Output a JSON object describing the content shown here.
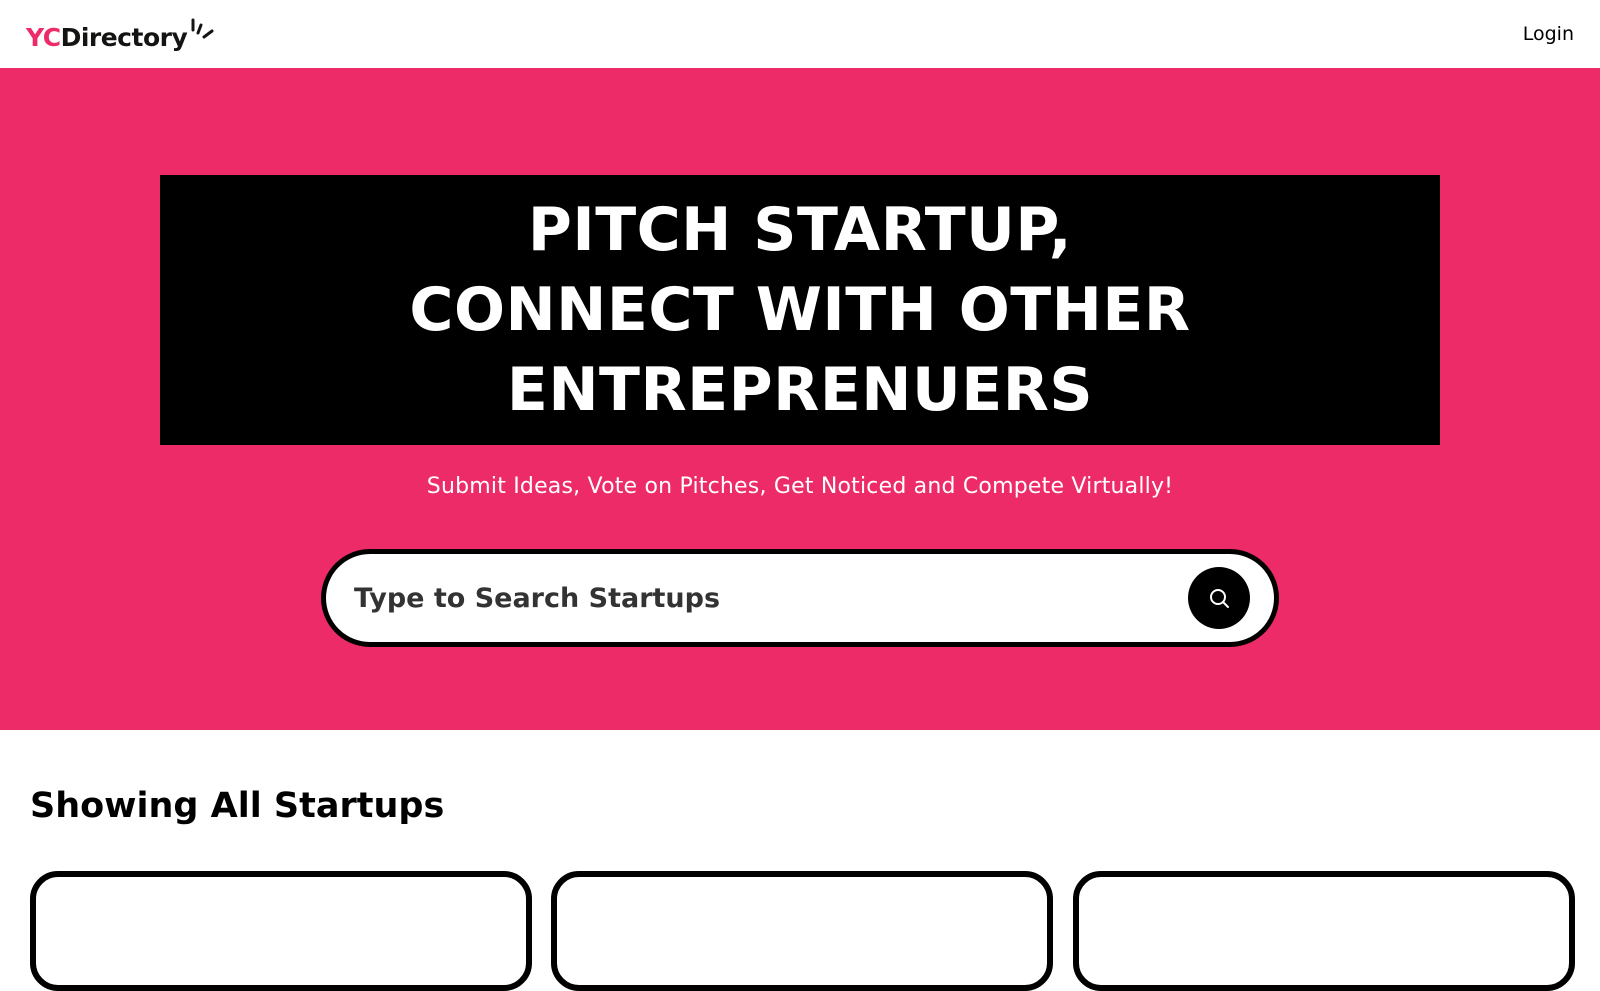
{
  "navbar": {
    "logo_yc": "YC",
    "logo_rest": "Directory",
    "login_label": "Login"
  },
  "hero": {
    "heading_lines": [
      "PITCH STARTUP,",
      "CONNECT WITH OTHER",
      "ENTREPRENUERS"
    ],
    "subheading": "Submit Ideas, Vote on Pitches, Get Noticed and Compete Virtually!"
  },
  "search": {
    "placeholder": "Type to Search Startups",
    "value": "",
    "button_icon": "search-icon"
  },
  "results": {
    "title": "Showing All Startups",
    "card_count_visible": 3
  },
  "colors": {
    "primary": "#EE2B69",
    "black": "#000000",
    "white": "#FFFFFF"
  }
}
